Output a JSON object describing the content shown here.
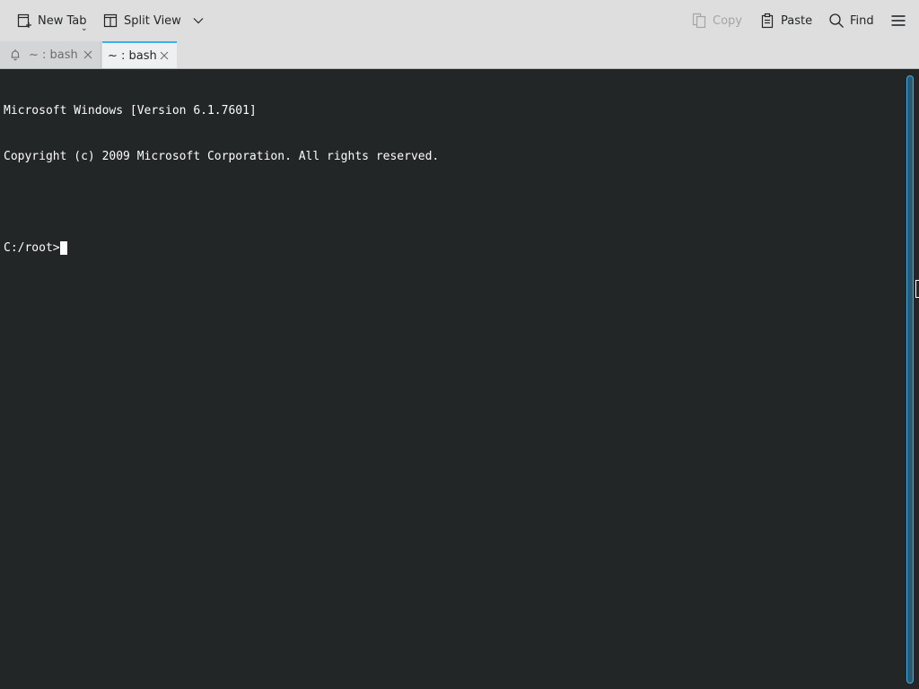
{
  "toolbar": {
    "new_tab": "New Tab",
    "split_view": "Split View",
    "copy": "Copy",
    "paste": "Paste",
    "find": "Find",
    "icons": {
      "new_tab": "new-tab-icon",
      "split_view": "split-view-icon",
      "split_view_dropdown": "chevron-down-icon",
      "copy": "copy-icon",
      "paste": "paste-icon",
      "find": "search-icon",
      "menu": "hamburger-menu-icon"
    }
  },
  "tabs": [
    {
      "label": "~ : bash",
      "active": false,
      "icon": "bell-icon"
    },
    {
      "label": "~ : bash",
      "active": true
    }
  ],
  "terminal": {
    "lines": [
      "Microsoft Windows [Version 6.1.7601]",
      "Copyright (c) 2009 Microsoft Corporation. All rights reserved.",
      ""
    ],
    "prompt": "C:/root>"
  },
  "colors": {
    "accent": "#3daee9",
    "terminal_bg": "#232627",
    "terminal_fg": "#fcfcfc",
    "toolbar_bg": "#dedede"
  }
}
